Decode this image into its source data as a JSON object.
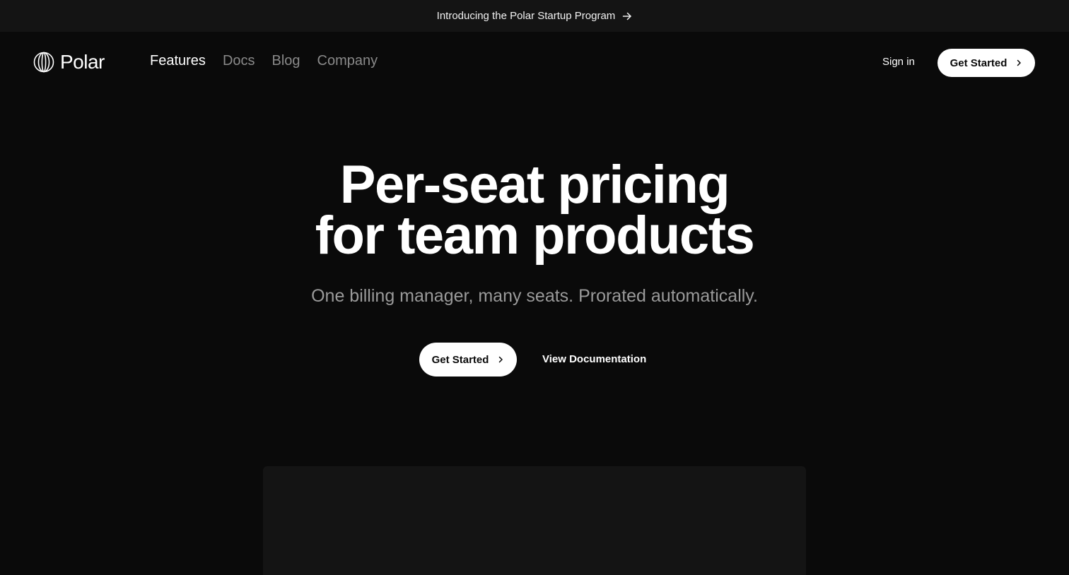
{
  "announcement": {
    "text": "Introducing the Polar Startup Program",
    "icon": "arrow-right-icon"
  },
  "brand": {
    "name": "Polar",
    "icon": "polar-logo-icon"
  },
  "nav": {
    "links": [
      {
        "label": "Features",
        "active": true
      },
      {
        "label": "Docs",
        "active": false
      },
      {
        "label": "Blog",
        "active": false
      },
      {
        "label": "Company",
        "active": false
      }
    ],
    "sign_in": "Sign in",
    "cta": "Get Started"
  },
  "hero": {
    "title_line1": "Per-seat pricing",
    "title_line2": "for team products",
    "subtitle": "One billing manager, many seats. Prorated automatically.",
    "primary_cta": "Get Started",
    "secondary_cta": "View Documentation"
  },
  "colors": {
    "background": "#0a0a0a",
    "announcement_bg": "#141414",
    "muted_text": "#8a8a8a",
    "button_bg": "#ffffff"
  }
}
